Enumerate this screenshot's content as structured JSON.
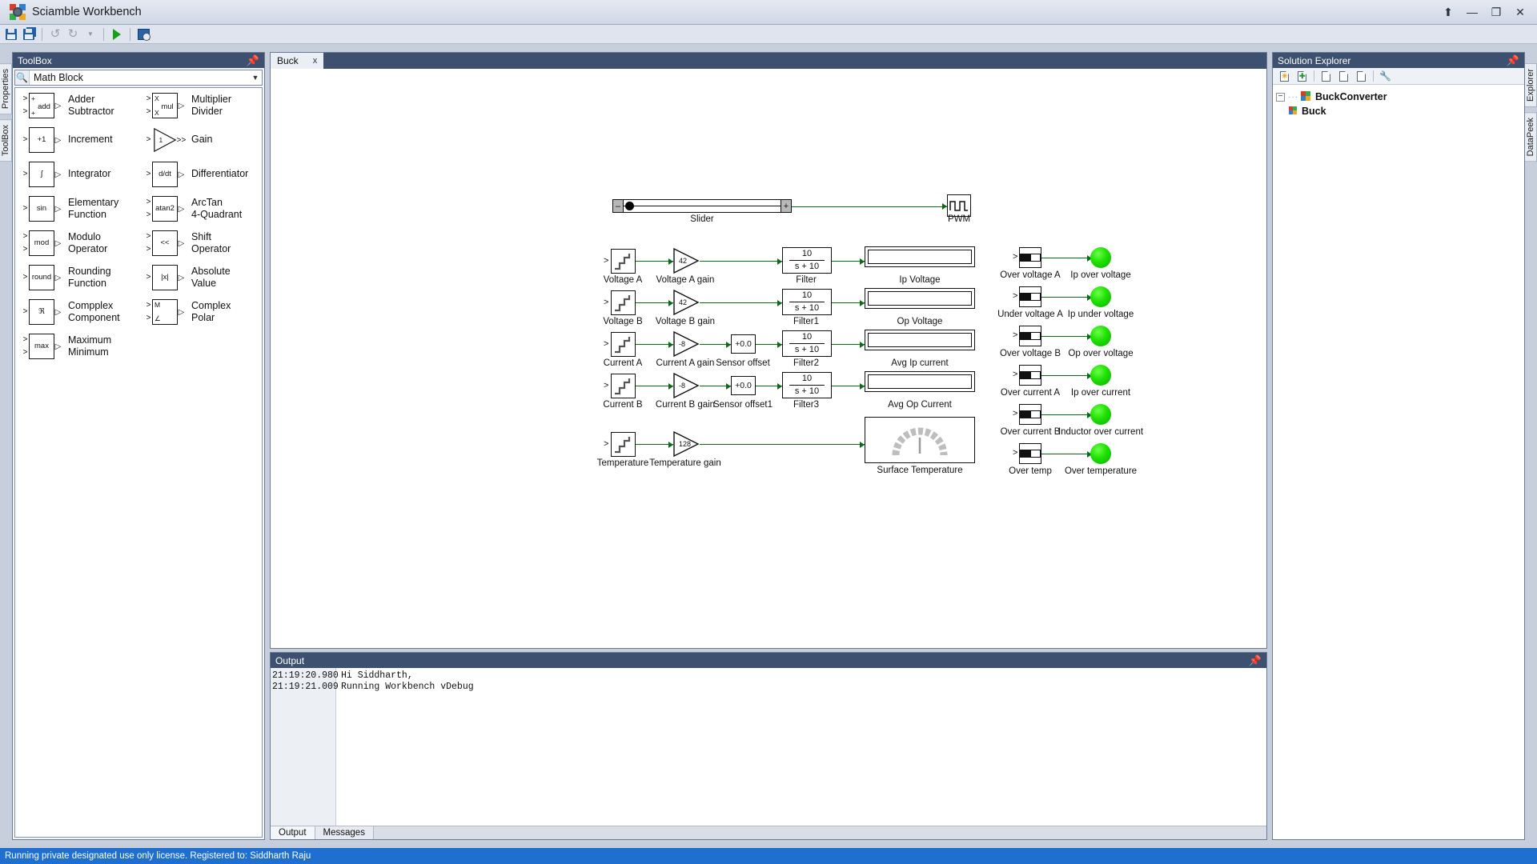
{
  "window": {
    "title": "Sciamble Workbench",
    "controls": {
      "upload": "⬆",
      "minimize": "—",
      "maximize": "❐",
      "close": "✕"
    }
  },
  "toolbar": {
    "save_label": "Save",
    "save_all_label": "Save All",
    "undo_label": "Undo",
    "redo_label": "Redo",
    "redo_more_label": "▾",
    "run_label": "Run",
    "configure_label": "Configure"
  },
  "left_strip": {
    "tabs": [
      "Properties",
      "ToolBox"
    ]
  },
  "right_strip": {
    "tabs": [
      "Explorer",
      "DataPeek"
    ]
  },
  "toolbox": {
    "title": "ToolBox",
    "pin": "📌",
    "search": {
      "value": "Math Block",
      "placeholder": "Search",
      "icon": "search-icon",
      "dropdown": "▼"
    },
    "items": [
      {
        "symbol": "add",
        "label": "Adder\nSubtractor",
        "inputs": 2,
        "kind": "box-sign",
        "sign1": "+",
        "sign2": "+"
      },
      {
        "symbol": "mul",
        "label": "Multiplier\nDivider",
        "inputs": 2,
        "kind": "box-sign",
        "sign1": "X",
        "sign2": "X"
      },
      {
        "symbol": "+1",
        "label": "Increment",
        "inputs": 1,
        "kind": "box"
      },
      {
        "symbol": "1",
        "label": "Gain",
        "inputs": 1,
        "kind": "triangle"
      },
      {
        "symbol": "∫",
        "label": "Integrator",
        "inputs": 1,
        "kind": "box"
      },
      {
        "symbol": "d/dt",
        "label": "Differentiator",
        "inputs": 1,
        "kind": "box"
      },
      {
        "symbol": "sin",
        "label": "Elementary\nFunction",
        "inputs": 1,
        "kind": "box"
      },
      {
        "symbol": "atan2",
        "label": "ArcTan\n4-Quadrant",
        "inputs": 2,
        "kind": "box"
      },
      {
        "symbol": "mod",
        "label": "Modulo\nOperator",
        "inputs": 2,
        "kind": "box"
      },
      {
        "symbol": "<<",
        "label": "Shift\nOperator",
        "inputs": 2,
        "kind": "box"
      },
      {
        "symbol": "round",
        "label": "Rounding\nFunction",
        "inputs": 1,
        "kind": "box"
      },
      {
        "symbol": "|x|",
        "label": "Absolute\nValue",
        "inputs": 1,
        "kind": "box"
      },
      {
        "symbol": "ℜ",
        "label": "Compplex\nComponent",
        "inputs": 1,
        "kind": "box"
      },
      {
        "symbol": "M∠",
        "label": "Complex\nPolar",
        "inputs": 2,
        "kind": "box-sign",
        "sign1": "M",
        "sign2": "∠"
      },
      {
        "symbol": "max",
        "label": "Maximum\nMinimum",
        "inputs": 2,
        "kind": "box"
      }
    ]
  },
  "document": {
    "tab_label": "Buck",
    "tab_close": "x"
  },
  "diagram": {
    "slider": {
      "label": "Slider",
      "minus": "–",
      "plus": "+"
    },
    "pwm": {
      "label": "PWM"
    },
    "rows": [
      {
        "source": "Voltage A",
        "gain_label": "Voltage A gain",
        "gain_value": "42",
        "offset_label": null,
        "offset_value": null,
        "filter_label": "Filter",
        "filter_num": "10",
        "filter_den": "s + 10",
        "display_label": "Ip Voltage"
      },
      {
        "source": "Voltage B",
        "gain_label": "Voltage B gain",
        "gain_value": "42",
        "offset_label": null,
        "offset_value": null,
        "filter_label": "Filter1",
        "filter_num": "10",
        "filter_den": "s + 10",
        "display_label": "Op Voltage"
      },
      {
        "source": "Current A",
        "gain_label": "Current A gain",
        "gain_value": "-8",
        "offset_label": "Sensor offset",
        "offset_value": "+0.0",
        "filter_label": "Filter2",
        "filter_num": "10",
        "filter_den": "s + 10",
        "display_label": "Avg Ip current"
      },
      {
        "source": "Current B",
        "gain_label": "Current B gain",
        "gain_value": "-8",
        "offset_label": "Sensor offset1",
        "offset_value": "+0.0",
        "filter_label": "Filter3",
        "filter_num": "10",
        "filter_den": "s + 10",
        "display_label": "Avg Op Current"
      },
      {
        "source": "Temperature",
        "gain_label": "Temperature gain",
        "gain_value": "128",
        "offset_label": null,
        "offset_value": null,
        "filter_label": null,
        "filter_num": null,
        "filter_den": null,
        "display_label": "Surface Temperature"
      }
    ],
    "indicators": [
      {
        "comparator": "Over voltage A",
        "led": "Ip over voltage",
        "led_color": "#18dc00"
      },
      {
        "comparator": "Under voltage A",
        "led": "Ip under voltage",
        "led_color": "#18dc00"
      },
      {
        "comparator": "Over voltage B",
        "led": "Op over voltage",
        "led_color": "#18dc00"
      },
      {
        "comparator": "Over current A",
        "led": "Ip over current",
        "led_color": "#18dc00"
      },
      {
        "comparator": "Over current B",
        "led": "Inductor over current",
        "led_color": "#18dc00"
      },
      {
        "comparator": "Over temp",
        "led": "Over temperature",
        "led_color": "#18dc00"
      }
    ],
    "wire_color": "#0a6b19"
  },
  "output": {
    "title": "Output",
    "pin": "📌",
    "lines": [
      {
        "time": "21:19:20.980",
        "text": "Hi Siddharth,"
      },
      {
        "time": "21:19:21.009",
        "text": "Running Workbench vDebug"
      }
    ],
    "tabs": [
      {
        "label": "Output",
        "active": true
      },
      {
        "label": "Messages",
        "active": false
      }
    ]
  },
  "solution_explorer": {
    "title": "Solution Explorer",
    "pin": "📌",
    "toolbar_buttons": [
      "new-item-icon",
      "add-existing-icon",
      "new-folder-icon",
      "copy-icon",
      "paste-icon",
      "properties-icon"
    ],
    "tree": [
      {
        "label": "BuckConverter",
        "expander": "−",
        "level": 0,
        "icon": "project-icon"
      },
      {
        "label": "Buck",
        "expander": "",
        "level": 1,
        "icon": "file-icon"
      }
    ]
  },
  "statusbar": {
    "text": "Running private designated use only license. Registered to: Siddharth Raju"
  }
}
